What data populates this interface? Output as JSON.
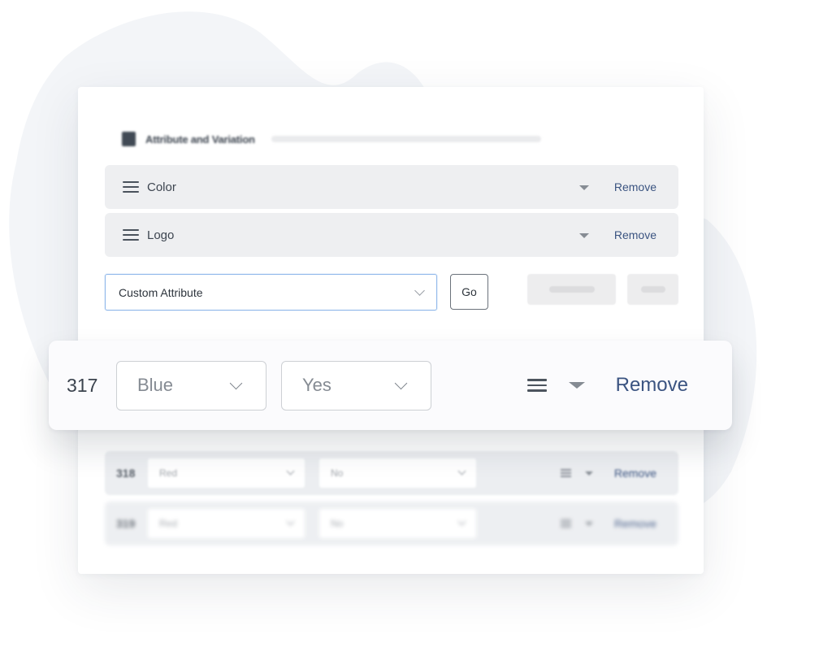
{
  "section": {
    "title": "Attribute and Variation"
  },
  "attributes": [
    {
      "name": "Color",
      "remove_label": "Remove"
    },
    {
      "name": "Logo",
      "remove_label": "Remove"
    }
  ],
  "add_attribute": {
    "selected": "Custom Attribute",
    "go_label": "Go"
  },
  "variations": [
    {
      "number": "317",
      "option1": "Blue",
      "option2": "Yes",
      "remove_label": "Remove"
    },
    {
      "number": "318",
      "option1": "Red",
      "option2": "No",
      "remove_label": "Remove"
    },
    {
      "number": "319",
      "option1": "Red",
      "option2": "No",
      "remove_label": "Remove"
    }
  ],
  "colors": {
    "link": "#3b5481",
    "row_bg": "#eeeff1",
    "focus_border": "#8fb7ea",
    "blob": "#f3f5f8"
  }
}
